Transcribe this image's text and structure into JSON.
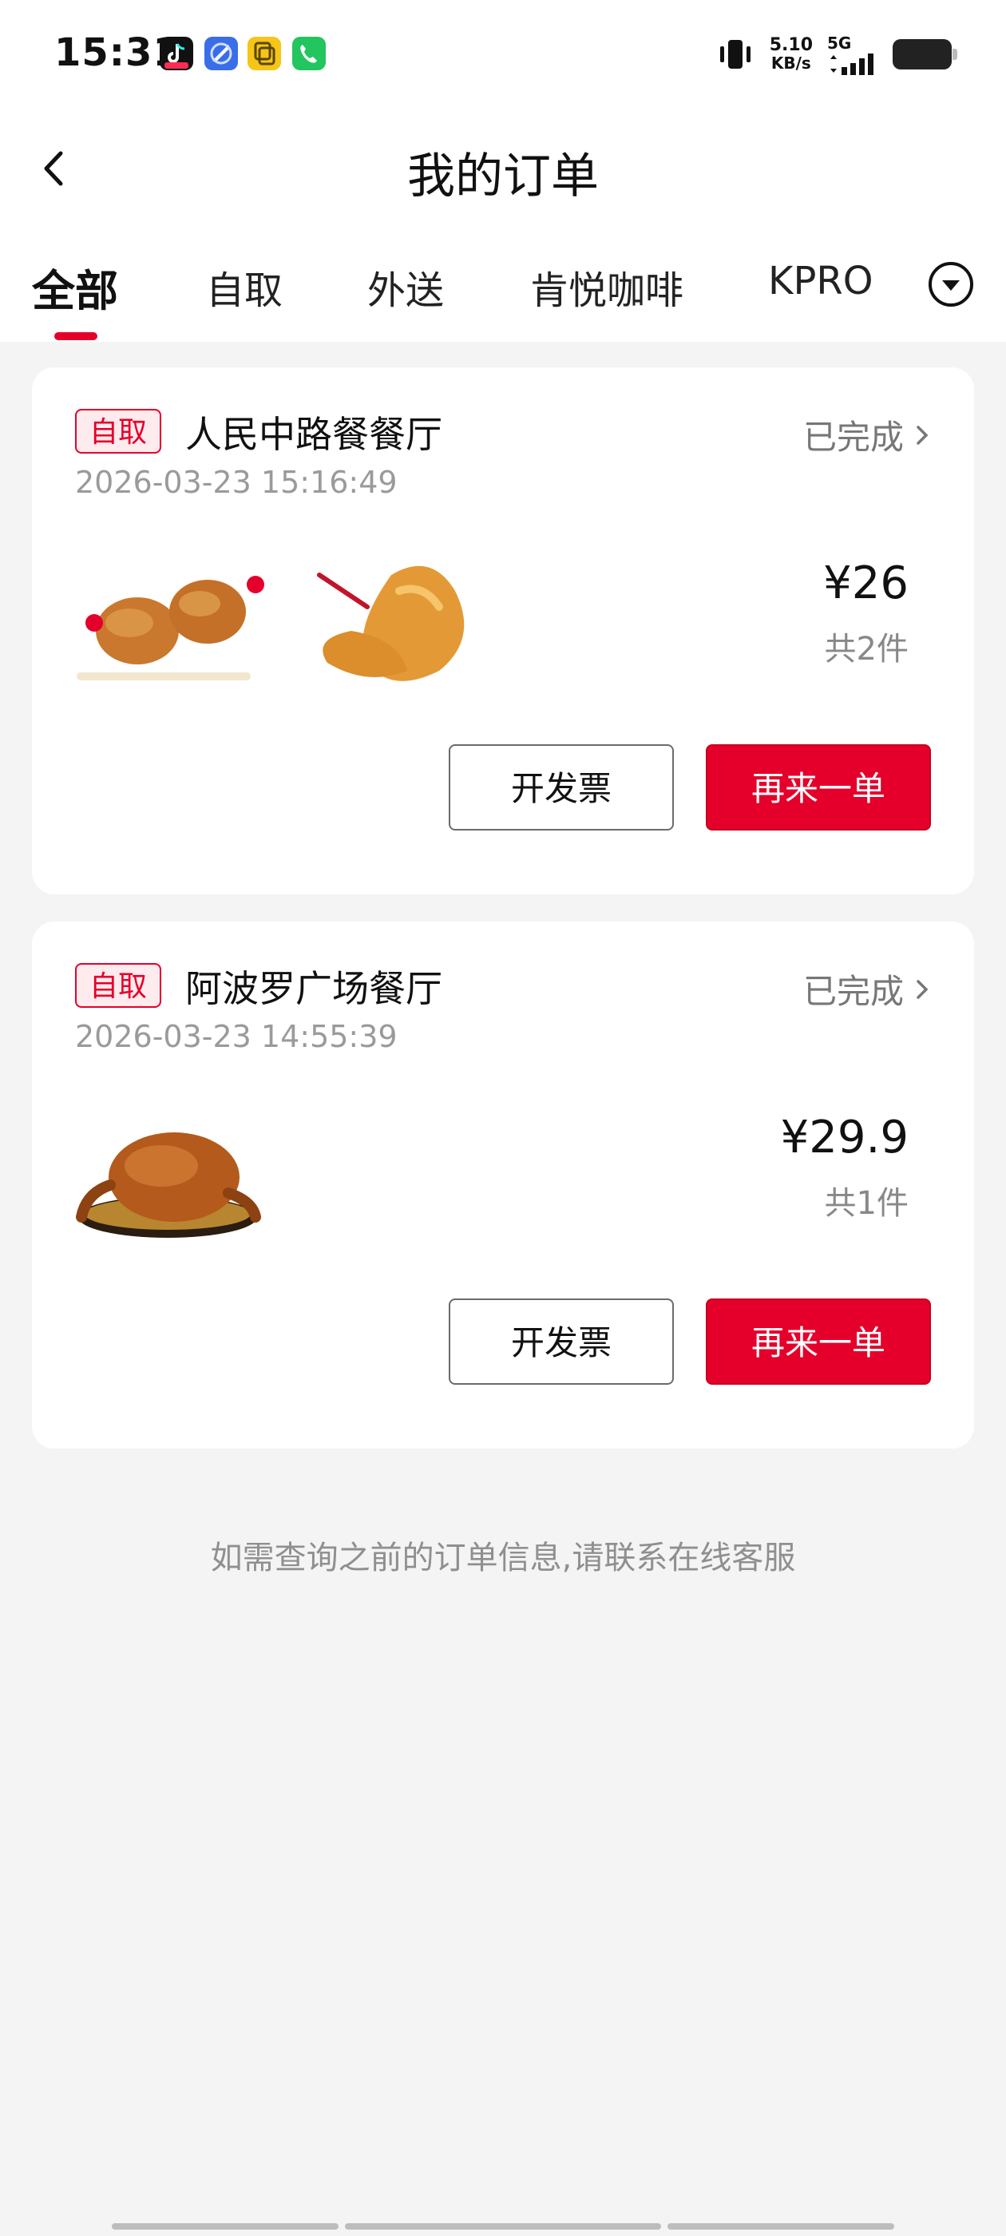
{
  "status_bar": {
    "time": "15:31",
    "apps": [
      "douyin-icon",
      "browser-icon",
      "copy-app-icon",
      "phone-app-icon"
    ],
    "net_speed_value": "5.10",
    "net_speed_unit": "KB/s",
    "network": "5G"
  },
  "header": {
    "title": "我的订单"
  },
  "tabs": [
    {
      "label": "全部",
      "active": true
    },
    {
      "label": "自取",
      "active": false
    },
    {
      "label": "外送",
      "active": false
    },
    {
      "label": "肯悦咖啡",
      "active": false
    },
    {
      "label": "KPRO",
      "active": false
    }
  ],
  "orders": [
    {
      "badge": "自取",
      "store": "人民中路餐餐厅",
      "status": "已完成",
      "time": "2026-03-23 15:16:49",
      "price": "¥26",
      "qty": "共2件",
      "invoice_label": "开发票",
      "reorder_label": "再来一单"
    },
    {
      "badge": "自取",
      "store": "阿波罗广场餐厅",
      "status": "已完成",
      "time": "2026-03-23 14:55:39",
      "price": "¥29.9",
      "qty": "共1件",
      "invoice_label": "开发票",
      "reorder_label": "再来一单"
    }
  ],
  "footer_note": "如需查询之前的订单信息,请联系在线客服",
  "colors": {
    "accent": "#e4002b",
    "background": "#f4f4f4",
    "card": "#ffffff"
  }
}
